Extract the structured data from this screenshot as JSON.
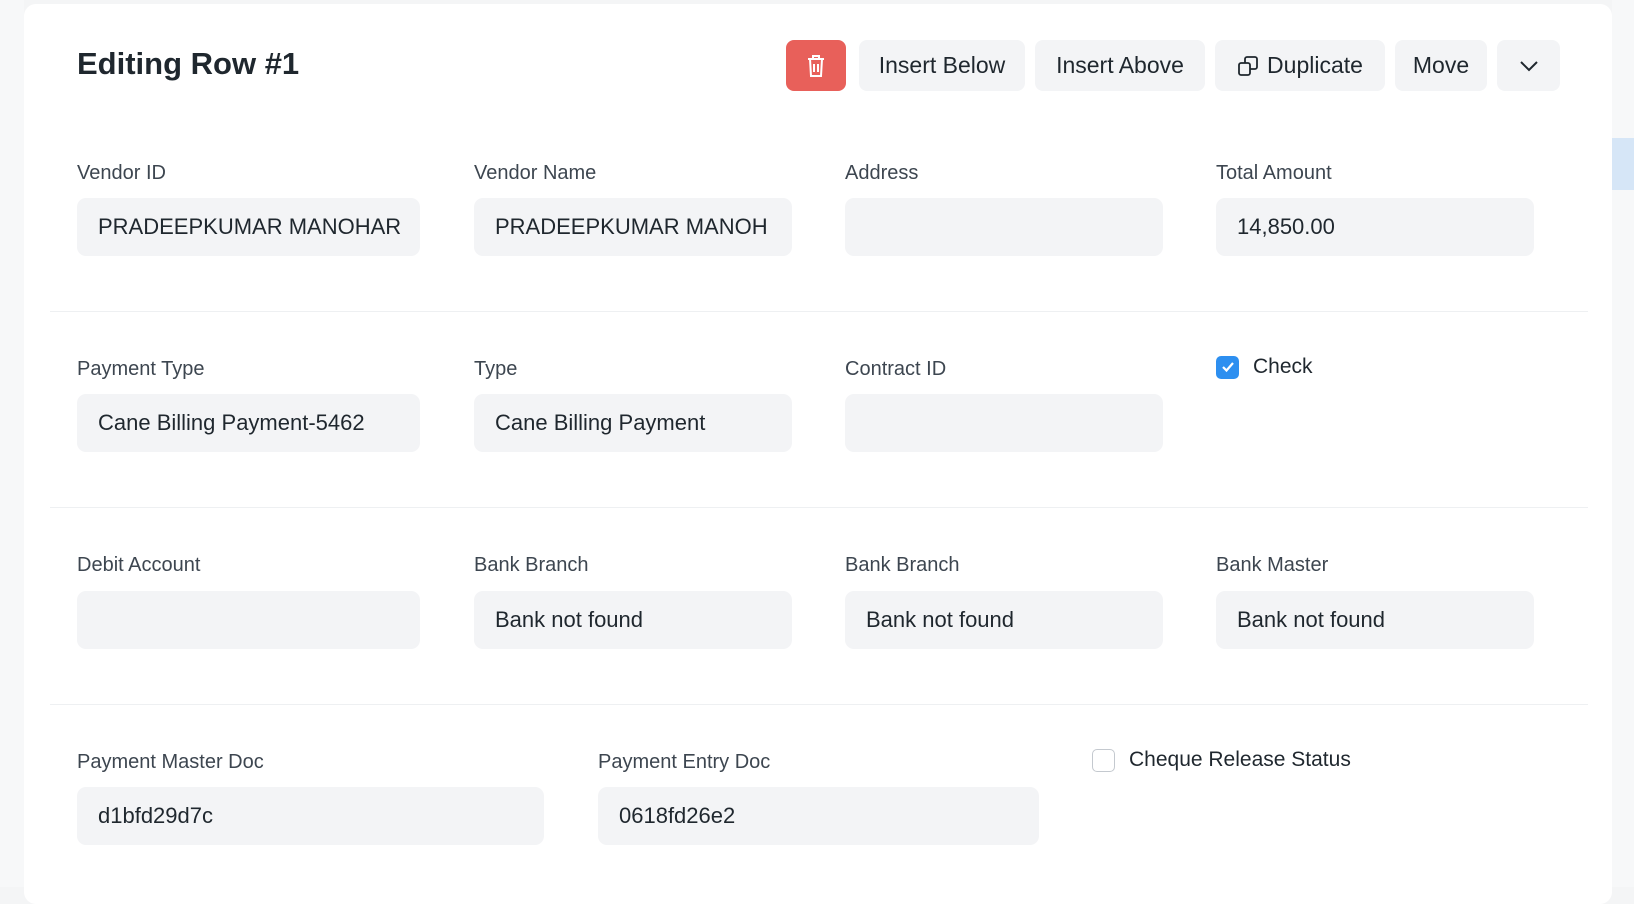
{
  "title": "Editing Row #1",
  "toolbar": {
    "delete_icon": "trash-icon",
    "insert_below": "Insert Below",
    "insert_above": "Insert Above",
    "duplicate": "Duplicate",
    "move": "Move",
    "more_icon": "chevron-down-icon"
  },
  "fields": {
    "vendor_id": {
      "label": "Vendor ID",
      "value": "PRADEEPKUMAR MANOHAR"
    },
    "vendor_name": {
      "label": "Vendor Name",
      "value": "PRADEEPKUMAR MANOH"
    },
    "address": {
      "label": "Address",
      "value": ""
    },
    "total_amount": {
      "label": "Total Amount",
      "value": "14,850.00"
    },
    "payment_type": {
      "label": "Payment Type",
      "value": "Cane Billing Payment-5462"
    },
    "type": {
      "label": "Type",
      "value": "Cane Billing Payment"
    },
    "contract_id": {
      "label": "Contract ID",
      "value": ""
    },
    "check": {
      "label": "Check",
      "checked": true
    },
    "debit_account": {
      "label": "Debit Account",
      "value": ""
    },
    "bank_branch_1": {
      "label": "Bank Branch",
      "value": "Bank not found"
    },
    "bank_branch_2": {
      "label": "Bank Branch",
      "value": "Bank not found"
    },
    "bank_master": {
      "label": "Bank Master",
      "value": "Bank not found"
    },
    "payment_master_doc": {
      "label": "Payment Master Doc",
      "value": "d1bfd29d7c"
    },
    "payment_entry_doc": {
      "label": "Payment Entry Doc",
      "value": "0618fd26e2"
    },
    "cheque_release_status": {
      "label": "Cheque Release Status",
      "checked": false
    }
  },
  "colors": {
    "delete": "#e8605a",
    "checkbox": "#2d8ff0"
  }
}
